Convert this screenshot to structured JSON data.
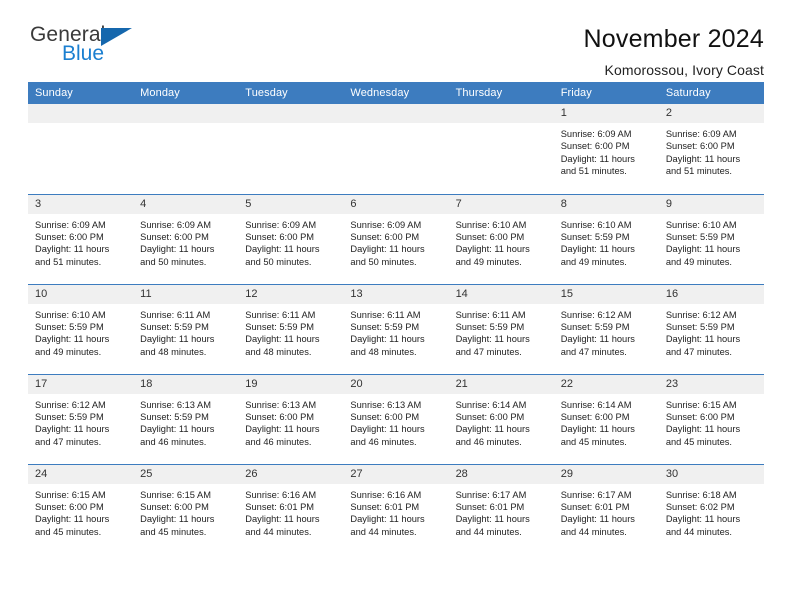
{
  "brand": {
    "name_part1": "General",
    "name_part2": "Blue",
    "triangle_color": "#1567ad",
    "blue_color": "#1b7fd0"
  },
  "header": {
    "title": "November 2024",
    "subtitle": "Komorossou, Ivory Coast"
  },
  "theme": {
    "header_blue": "#3d7cbf",
    "daynum_gray": "#f0f0f0",
    "text": "#222222"
  },
  "weekdays": [
    "Sunday",
    "Monday",
    "Tuesday",
    "Wednesday",
    "Thursday",
    "Friday",
    "Saturday"
  ],
  "labels": {
    "sunrise_prefix": "Sunrise: ",
    "sunset_prefix": "Sunset: ",
    "daylight_prefix": "Daylight: "
  },
  "weeks": [
    [
      {
        "day": "",
        "empty": true
      },
      {
        "day": "",
        "empty": true
      },
      {
        "day": "",
        "empty": true
      },
      {
        "day": "",
        "empty": true
      },
      {
        "day": "",
        "empty": true
      },
      {
        "day": "1",
        "sunrise": "Sunrise: 6:09 AM",
        "sunset": "Sunset: 6:00 PM",
        "daylight1": "Daylight: 11 hours",
        "daylight2": "and 51 minutes."
      },
      {
        "day": "2",
        "sunrise": "Sunrise: 6:09 AM",
        "sunset": "Sunset: 6:00 PM",
        "daylight1": "Daylight: 11 hours",
        "daylight2": "and 51 minutes."
      }
    ],
    [
      {
        "day": "3",
        "sunrise": "Sunrise: 6:09 AM",
        "sunset": "Sunset: 6:00 PM",
        "daylight1": "Daylight: 11 hours",
        "daylight2": "and 51 minutes."
      },
      {
        "day": "4",
        "sunrise": "Sunrise: 6:09 AM",
        "sunset": "Sunset: 6:00 PM",
        "daylight1": "Daylight: 11 hours",
        "daylight2": "and 50 minutes."
      },
      {
        "day": "5",
        "sunrise": "Sunrise: 6:09 AM",
        "sunset": "Sunset: 6:00 PM",
        "daylight1": "Daylight: 11 hours",
        "daylight2": "and 50 minutes."
      },
      {
        "day": "6",
        "sunrise": "Sunrise: 6:09 AM",
        "sunset": "Sunset: 6:00 PM",
        "daylight1": "Daylight: 11 hours",
        "daylight2": "and 50 minutes."
      },
      {
        "day": "7",
        "sunrise": "Sunrise: 6:10 AM",
        "sunset": "Sunset: 6:00 PM",
        "daylight1": "Daylight: 11 hours",
        "daylight2": "and 49 minutes."
      },
      {
        "day": "8",
        "sunrise": "Sunrise: 6:10 AM",
        "sunset": "Sunset: 5:59 PM",
        "daylight1": "Daylight: 11 hours",
        "daylight2": "and 49 minutes."
      },
      {
        "day": "9",
        "sunrise": "Sunrise: 6:10 AM",
        "sunset": "Sunset: 5:59 PM",
        "daylight1": "Daylight: 11 hours",
        "daylight2": "and 49 minutes."
      }
    ],
    [
      {
        "day": "10",
        "sunrise": "Sunrise: 6:10 AM",
        "sunset": "Sunset: 5:59 PM",
        "daylight1": "Daylight: 11 hours",
        "daylight2": "and 49 minutes."
      },
      {
        "day": "11",
        "sunrise": "Sunrise: 6:11 AM",
        "sunset": "Sunset: 5:59 PM",
        "daylight1": "Daylight: 11 hours",
        "daylight2": "and 48 minutes."
      },
      {
        "day": "12",
        "sunrise": "Sunrise: 6:11 AM",
        "sunset": "Sunset: 5:59 PM",
        "daylight1": "Daylight: 11 hours",
        "daylight2": "and 48 minutes."
      },
      {
        "day": "13",
        "sunrise": "Sunrise: 6:11 AM",
        "sunset": "Sunset: 5:59 PM",
        "daylight1": "Daylight: 11 hours",
        "daylight2": "and 48 minutes."
      },
      {
        "day": "14",
        "sunrise": "Sunrise: 6:11 AM",
        "sunset": "Sunset: 5:59 PM",
        "daylight1": "Daylight: 11 hours",
        "daylight2": "and 47 minutes."
      },
      {
        "day": "15",
        "sunrise": "Sunrise: 6:12 AM",
        "sunset": "Sunset: 5:59 PM",
        "daylight1": "Daylight: 11 hours",
        "daylight2": "and 47 minutes."
      },
      {
        "day": "16",
        "sunrise": "Sunrise: 6:12 AM",
        "sunset": "Sunset: 5:59 PM",
        "daylight1": "Daylight: 11 hours",
        "daylight2": "and 47 minutes."
      }
    ],
    [
      {
        "day": "17",
        "sunrise": "Sunrise: 6:12 AM",
        "sunset": "Sunset: 5:59 PM",
        "daylight1": "Daylight: 11 hours",
        "daylight2": "and 47 minutes."
      },
      {
        "day": "18",
        "sunrise": "Sunrise: 6:13 AM",
        "sunset": "Sunset: 5:59 PM",
        "daylight1": "Daylight: 11 hours",
        "daylight2": "and 46 minutes."
      },
      {
        "day": "19",
        "sunrise": "Sunrise: 6:13 AM",
        "sunset": "Sunset: 6:00 PM",
        "daylight1": "Daylight: 11 hours",
        "daylight2": "and 46 minutes."
      },
      {
        "day": "20",
        "sunrise": "Sunrise: 6:13 AM",
        "sunset": "Sunset: 6:00 PM",
        "daylight1": "Daylight: 11 hours",
        "daylight2": "and 46 minutes."
      },
      {
        "day": "21",
        "sunrise": "Sunrise: 6:14 AM",
        "sunset": "Sunset: 6:00 PM",
        "daylight1": "Daylight: 11 hours",
        "daylight2": "and 46 minutes."
      },
      {
        "day": "22",
        "sunrise": "Sunrise: 6:14 AM",
        "sunset": "Sunset: 6:00 PM",
        "daylight1": "Daylight: 11 hours",
        "daylight2": "and 45 minutes."
      },
      {
        "day": "23",
        "sunrise": "Sunrise: 6:15 AM",
        "sunset": "Sunset: 6:00 PM",
        "daylight1": "Daylight: 11 hours",
        "daylight2": "and 45 minutes."
      }
    ],
    [
      {
        "day": "24",
        "sunrise": "Sunrise: 6:15 AM",
        "sunset": "Sunset: 6:00 PM",
        "daylight1": "Daylight: 11 hours",
        "daylight2": "and 45 minutes."
      },
      {
        "day": "25",
        "sunrise": "Sunrise: 6:15 AM",
        "sunset": "Sunset: 6:00 PM",
        "daylight1": "Daylight: 11 hours",
        "daylight2": "and 45 minutes."
      },
      {
        "day": "26",
        "sunrise": "Sunrise: 6:16 AM",
        "sunset": "Sunset: 6:01 PM",
        "daylight1": "Daylight: 11 hours",
        "daylight2": "and 44 minutes."
      },
      {
        "day": "27",
        "sunrise": "Sunrise: 6:16 AM",
        "sunset": "Sunset: 6:01 PM",
        "daylight1": "Daylight: 11 hours",
        "daylight2": "and 44 minutes."
      },
      {
        "day": "28",
        "sunrise": "Sunrise: 6:17 AM",
        "sunset": "Sunset: 6:01 PM",
        "daylight1": "Daylight: 11 hours",
        "daylight2": "and 44 minutes."
      },
      {
        "day": "29",
        "sunrise": "Sunrise: 6:17 AM",
        "sunset": "Sunset: 6:01 PM",
        "daylight1": "Daylight: 11 hours",
        "daylight2": "and 44 minutes."
      },
      {
        "day": "30",
        "sunrise": "Sunrise: 6:18 AM",
        "sunset": "Sunset: 6:02 PM",
        "daylight1": "Daylight: 11 hours",
        "daylight2": "and 44 minutes."
      }
    ]
  ]
}
